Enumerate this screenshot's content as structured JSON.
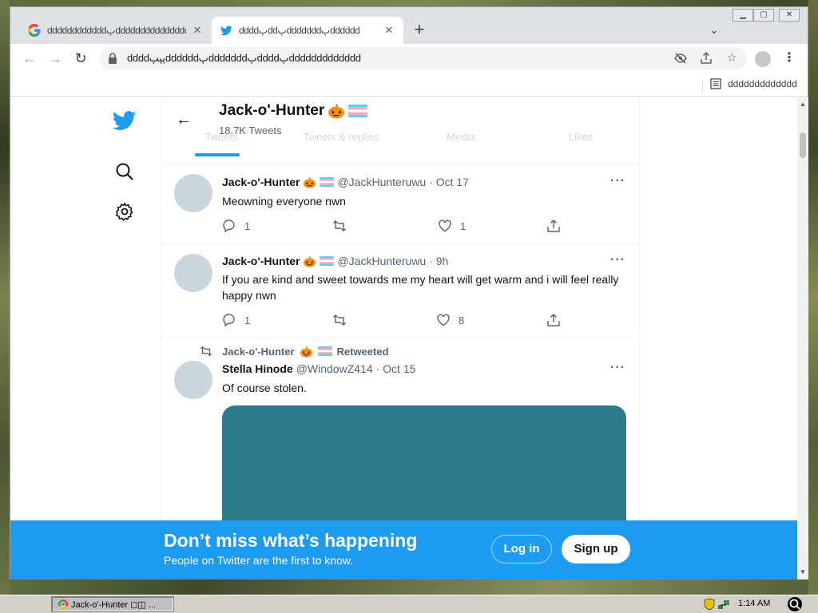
{
  "browser": {
    "tabs": [
      {
        "title": "ddddddddddddپddddddddddddddd",
        "active": false,
        "favicon": "google-g-icon"
      },
      {
        "title": "ddddپddپdddddddپdddddd",
        "active": true,
        "favicon": "twitter-bird-icon"
      }
    ],
    "url": "ddddپپپddddddپdddddddپddddپddddddddddddd",
    "bookmark_label": "ddddddddddddd"
  },
  "profile": {
    "name": "Jack-o'-Hunter",
    "tweet_count": "18.7K Tweets",
    "tabs": [
      "Tweets",
      "Tweets & replies",
      "Media",
      "Likes"
    ]
  },
  "tweets": [
    {
      "name": "Jack-o'-Hunter",
      "handle": "@JackHunteruwu",
      "time": "· Oct 17",
      "text": "Meowning everyone nwn",
      "replies": "1",
      "retweets": "",
      "likes": "1"
    },
    {
      "name": "Jack-o'-Hunter",
      "handle": "@JackHunteruwu",
      "time": "· 9h",
      "text": "If you are kind and sweet towards me my heart will get warm and i will feel really happy nwn",
      "replies": "1",
      "retweets": "",
      "likes": "8"
    },
    {
      "retweeted_by": "Jack-o'-Hunter",
      "retweeted_label": "Retweeted",
      "name": "Stella Hinode",
      "handle": "@WindowZ414",
      "time": "· Oct 15",
      "text": "Of course stolen.",
      "media_color": "#2c7a8c"
    }
  ],
  "banner": {
    "title": "Don’t miss what’s happening",
    "subtitle": "People on Twitter are the first to know.",
    "login": "Log in",
    "signup": "Sign up"
  },
  "taskbar": {
    "task_label": "Jack-o'-Hunter ◻◫ ...",
    "clock": "1:14 AM"
  },
  "colors": {
    "twitter_blue": "#1d9bf0",
    "text_dark": "#0f1419",
    "text_gray": "#536471"
  }
}
